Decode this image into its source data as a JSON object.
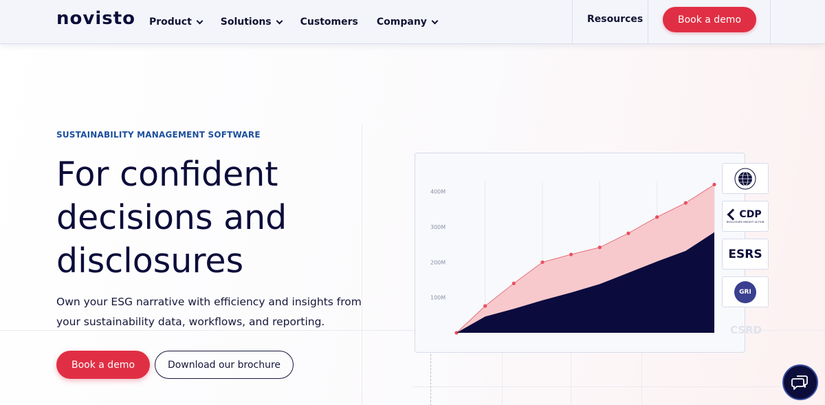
{
  "nav": {
    "logo": "novisto",
    "menu": [
      {
        "label": "Product",
        "dropdown": true
      },
      {
        "label": "Solutions",
        "dropdown": true
      },
      {
        "label": "Customers",
        "dropdown": false
      },
      {
        "label": "Company",
        "dropdown": true
      }
    ],
    "resources": "Resources",
    "cta": "Book a demo"
  },
  "hero": {
    "eyebrow": "SUSTAINABILITY MANAGEMENT SOFTWARE",
    "headline_lines": [
      "For confident",
      "decisions and",
      "disclosures"
    ],
    "subtext": "Own your ESG narrative with efficiency and insights from your sustainability data, workflows, and reporting.",
    "primary_cta": "Book a demo",
    "secondary_cta": "Download our brochure"
  },
  "chart_data": {
    "type": "area",
    "title": "",
    "xlabel": "",
    "ylabel": "",
    "ylim": [
      0,
      450
    ],
    "y_ticks": [
      {
        "value": 100,
        "label": "100M"
      },
      {
        "value": 200,
        "label": "200M"
      },
      {
        "value": 300,
        "label": "300M"
      },
      {
        "value": 400,
        "label": "400M"
      }
    ],
    "x": [
      0,
      1,
      2,
      3,
      4,
      5,
      6,
      7,
      8,
      9
    ],
    "series": [
      {
        "values": [
          0,
          76,
          140,
          200,
          222,
          242,
          282,
          328,
          368,
          420
        ],
        "color": "#f7c9cc",
        "line_color": "#e8707a",
        "markers": true
      },
      {
        "values": [
          0,
          46,
          68,
          92,
          114,
          138,
          170,
          202,
          232,
          285
        ],
        "color": "#0b0b3e",
        "markers": false
      }
    ]
  },
  "badges": [
    {
      "name": "un-global-compact-badge",
      "label": "UN GLOBAL COMPACT"
    },
    {
      "name": "cdp-badge",
      "label": "CDP",
      "sublabel": "DISCLOSURE INSIGHT ACTION"
    },
    {
      "name": "esrs-badge",
      "label": "ESRS"
    },
    {
      "name": "gri-badge",
      "label": "GRI"
    }
  ],
  "csrd_label": "CSRD",
  "colors": {
    "brand_red": "#e02f44",
    "navy": "#0c0d3a",
    "eyebrow_blue": "#1c4f9c"
  },
  "icons": {
    "chat": "chat-bubbles-icon"
  }
}
